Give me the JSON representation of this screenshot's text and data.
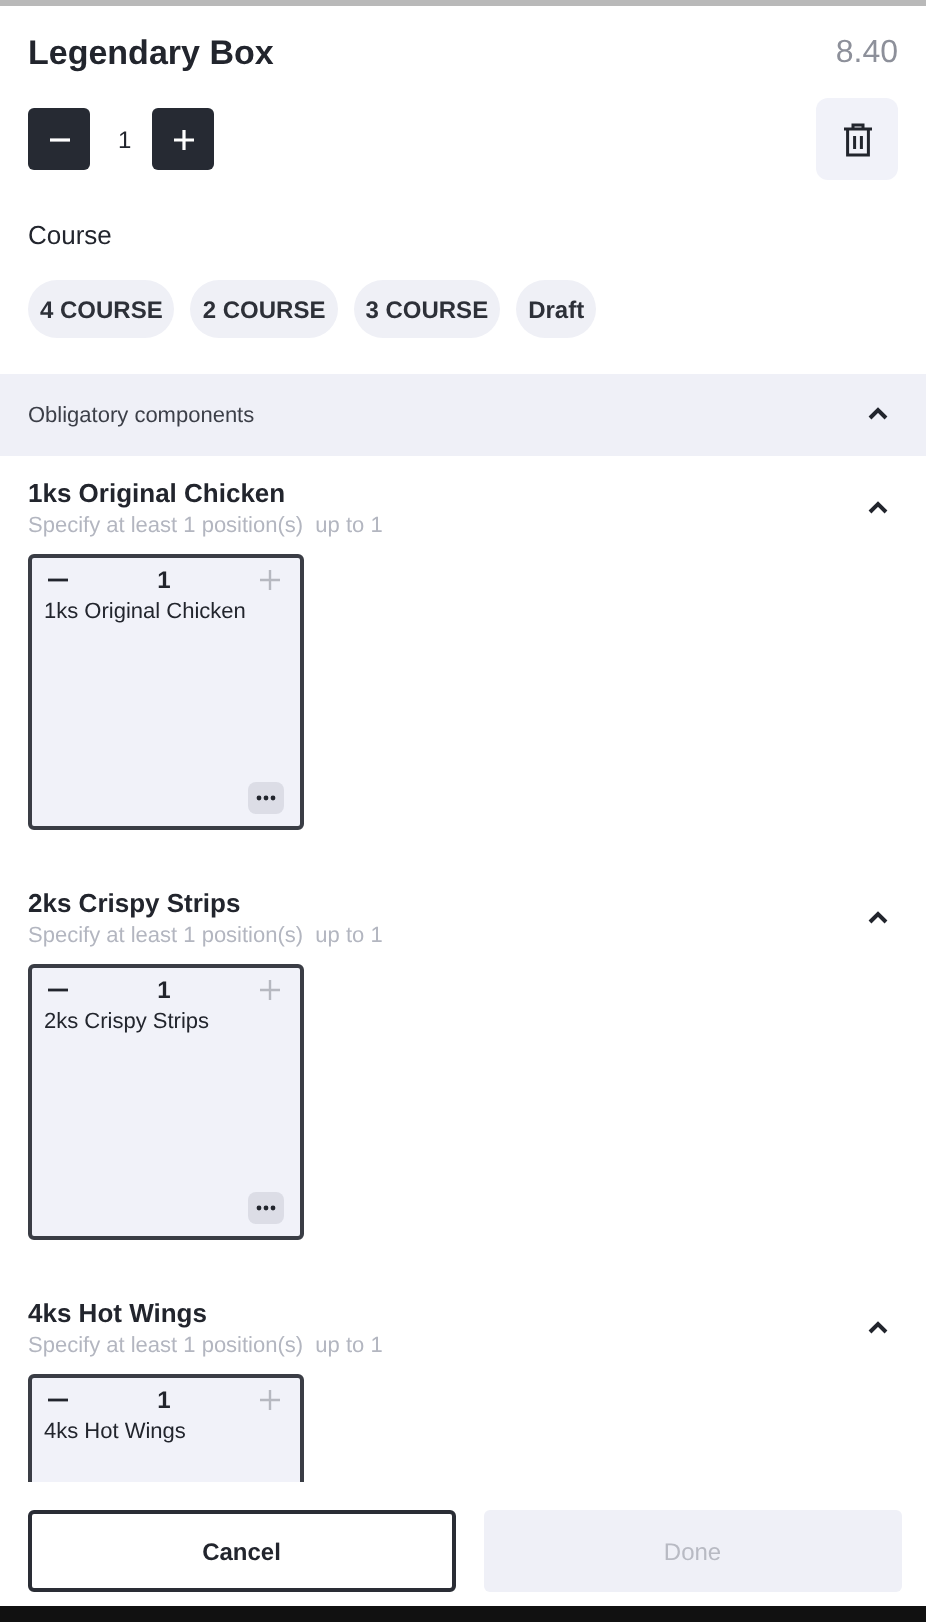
{
  "product": {
    "title": "Legendary Box",
    "price": "8.40",
    "quantity": "1"
  },
  "course": {
    "label": "Course",
    "options": [
      {
        "label": "4 COURSE",
        "selected": false
      },
      {
        "label": "2 COURSE",
        "selected": false
      },
      {
        "label": "3 COURSE",
        "selected": false
      },
      {
        "label": "Draft",
        "selected": false
      }
    ]
  },
  "section": {
    "title": "Obligatory components",
    "expanded": true
  },
  "groups": [
    {
      "title": "1ks Original Chicken",
      "hint": "Specify at least 1 position(s)  up to 1",
      "expanded": true,
      "items": [
        {
          "name": "1ks Original Chicken",
          "quantity": "1",
          "plus_disabled": true,
          "has_menu": true
        }
      ]
    },
    {
      "title": "2ks Crispy Strips",
      "hint": "Specify at least 1 position(s)  up to 1",
      "expanded": true,
      "items": [
        {
          "name": "2ks Crispy Strips",
          "quantity": "1",
          "plus_disabled": true,
          "has_menu": true
        }
      ]
    },
    {
      "title": "4ks Hot Wings",
      "hint": "Specify at least 1 position(s)  up to 1",
      "expanded": true,
      "items": [
        {
          "name": "4ks Hot Wings",
          "quantity": "1",
          "plus_disabled": true
        }
      ]
    }
  ],
  "buttons": [
    {
      "label": "Cancel",
      "kind": "secondary",
      "disabled": false
    },
    {
      "label": "Done",
      "kind": "primary",
      "disabled": true
    }
  ]
}
